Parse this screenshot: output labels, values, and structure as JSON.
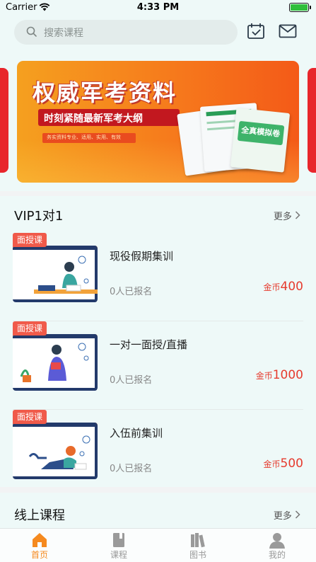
{
  "status_bar": {
    "carrier": "Carrier",
    "time": "4:33 PM"
  },
  "header": {
    "search_placeholder": "搜索课程",
    "icons": [
      "calendar-check-icon",
      "mail-icon"
    ]
  },
  "banner": {
    "title": "权威军考资料",
    "subtitle": "时刻紧随最新军考大纲",
    "tagline": "务实资料专业、适用、实用、有效",
    "book_title": "全真模拟卷"
  },
  "vip_section": {
    "title": "VIP1对1",
    "more_label": "更多",
    "courses": [
      {
        "badge": "面授课",
        "name": "现役假期集训",
        "enroll": "0人已报名",
        "price_unit": "金币",
        "price": "400"
      },
      {
        "badge": "面授课",
        "name": "一对一面授/直播",
        "enroll": "0人已报名",
        "price_unit": "金币",
        "price": "1000"
      },
      {
        "badge": "面授课",
        "name": "入伍前集训",
        "enroll": "0人已报名",
        "price_unit": "金币",
        "price": "500"
      }
    ]
  },
  "online_section": {
    "title": "线上课程",
    "more_label": "更多"
  },
  "tabbar": {
    "tabs": [
      {
        "label": "首页",
        "icon": "home-icon",
        "active": true
      },
      {
        "label": "课程",
        "icon": "course-book-icon",
        "active": false
      },
      {
        "label": "图书",
        "icon": "books-icon",
        "active": false
      },
      {
        "label": "我的",
        "icon": "user-icon",
        "active": false
      }
    ]
  },
  "colors": {
    "accent": "#f58a1f",
    "price": "#e63b2e",
    "badge": "#f05a4a",
    "background": "#eef9f8"
  }
}
